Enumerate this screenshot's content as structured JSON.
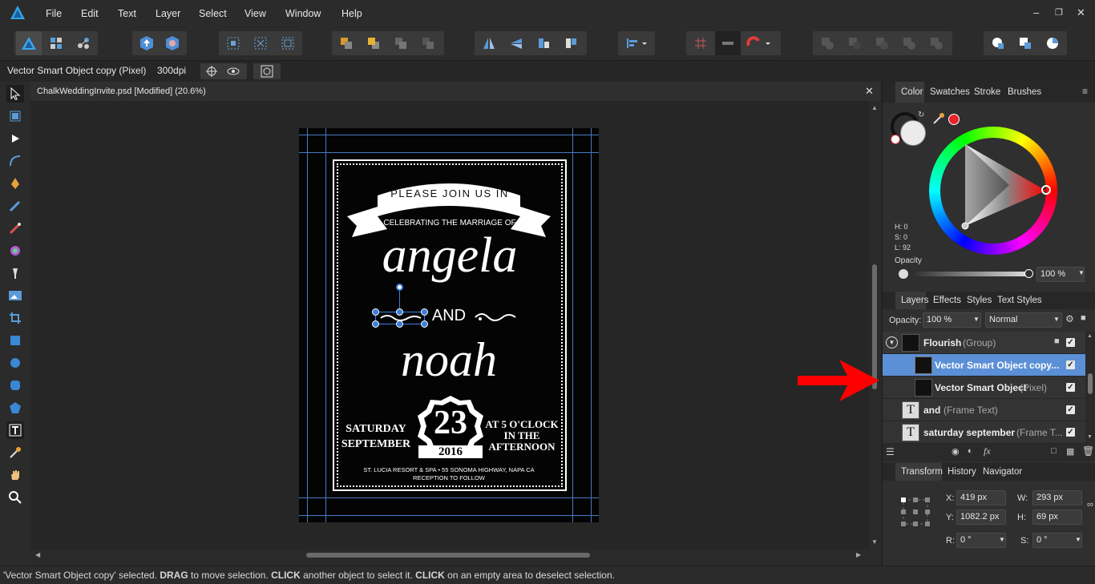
{
  "menu": {
    "items": [
      "File",
      "Edit",
      "Text",
      "Layer",
      "Select",
      "View",
      "Window",
      "Help"
    ]
  },
  "context_bar": {
    "selection_label": "Vector Smart Object copy (Pixel)",
    "dpi": "300dpi"
  },
  "document": {
    "tab_title": "ChalkWeddingInvite.psd [Modified] (20.6%)"
  },
  "invite": {
    "banner_text": "PLEASE JOIN US IN",
    "subtitle": "CELEBRATING THE MARRIAGE OF",
    "name1": "angela",
    "and_text": "AND",
    "name2": "noah",
    "day": "SATURDAY",
    "month": "SEPTEMBER",
    "date_num": "23",
    "year": "2016",
    "time_line1": "AT 5 O'CLOCK",
    "time_line2": "IN THE",
    "time_line3": "AFTERNOON",
    "address": "ST. LUCIA RESORT & SPA • 55 SONOMA HIGHWAY, NAPA CA",
    "reception": "RECEPTION TO FOLLOW"
  },
  "color_panel": {
    "tabs": [
      "Color",
      "Swatches",
      "Stroke",
      "Brushes"
    ],
    "h": "H: 0",
    "s": "S: 0",
    "l": "L: 92",
    "opacity_label": "Opacity",
    "opacity_value": "100 %",
    "accent_red": "#e8232a"
  },
  "layers_panel": {
    "tabs": [
      "Layers",
      "Effects",
      "Styles",
      "Text Styles"
    ],
    "opacity_label": "Opacity:",
    "opacity_value": "100 %",
    "blend_mode": "Normal",
    "layers": [
      {
        "name": "Flourish",
        "type": "(Group)"
      },
      {
        "name": "Vector Smart Object copy...",
        "type": ""
      },
      {
        "name": "Vector Smart Object",
        "type": "(Pixel)"
      },
      {
        "name": "and",
        "type": "(Frame Text)"
      },
      {
        "name": "saturday september",
        "type": "(Frame T..."
      }
    ]
  },
  "transform_panel": {
    "tabs": [
      "Transform",
      "History",
      "Navigator"
    ],
    "x_label": "X:",
    "x": "419 px",
    "y_label": "Y:",
    "y": "1082.2 px",
    "w_label": "W:",
    "w": "293 px",
    "h_label": "H:",
    "h": "69 px",
    "r_label": "R:",
    "r": "0 °",
    "s_label": "S:",
    "s": "0 °"
  },
  "status": {
    "p1": "'Vector Smart Object copy' selected. ",
    "b1": "DRAG",
    "p2": " to move selection. ",
    "b2": "CLICK",
    "p3": " another object to select it. ",
    "b3": "CLICK",
    "p4": " on an empty area to deselect selection."
  }
}
